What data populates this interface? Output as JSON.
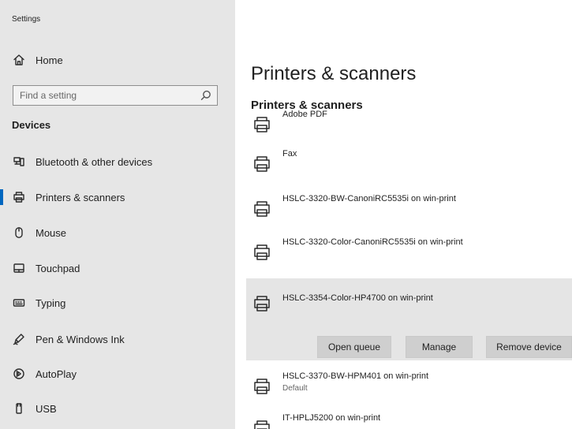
{
  "window": {
    "title": "Settings",
    "accent_color": "#2f6fc7"
  },
  "sidebar": {
    "home": {
      "label": "Home",
      "icon": "home-icon"
    },
    "search": {
      "placeholder": "Find a setting",
      "icon": "search-icon"
    },
    "section_title": "Devices",
    "items": [
      {
        "label": "Bluetooth & other devices",
        "icon": "bluetooth-devices-icon",
        "active": false
      },
      {
        "label": "Printers & scanners",
        "icon": "printer-icon",
        "active": true
      },
      {
        "label": "Mouse",
        "icon": "mouse-icon",
        "active": false
      },
      {
        "label": "Touchpad",
        "icon": "touchpad-icon",
        "active": false
      },
      {
        "label": "Typing",
        "icon": "keyboard-icon",
        "active": false
      },
      {
        "label": "Pen & Windows Ink",
        "icon": "pen-icon",
        "active": false
      },
      {
        "label": "AutoPlay",
        "icon": "autoplay-icon",
        "active": false
      },
      {
        "label": "USB",
        "icon": "usb-icon",
        "active": false
      }
    ]
  },
  "main": {
    "page_title": "Printers & scanners",
    "section_title": "Printers & scanners",
    "printers": [
      {
        "name": "Adobe PDF",
        "status": "",
        "selected": false
      },
      {
        "name": "Fax",
        "status": "",
        "selected": false
      },
      {
        "name": "HSLC-3320-BW-CanoniRC5535i on win-print",
        "status": "",
        "selected": false
      },
      {
        "name": "HSLC-3320-Color-CanoniRC5535i on win-print",
        "status": "",
        "selected": false
      },
      {
        "name": "HSLC-3354-Color-HP4700 on win-print",
        "status": "",
        "selected": true
      },
      {
        "name": "HSLC-3370-BW-HPM401 on win-print",
        "status": "Default",
        "selected": false
      },
      {
        "name": "IT-HPLJ5200 on win-print",
        "status": "",
        "selected": false
      }
    ],
    "selected_actions": {
      "open_queue": "Open queue",
      "manage": "Manage",
      "remove": "Remove device"
    }
  }
}
